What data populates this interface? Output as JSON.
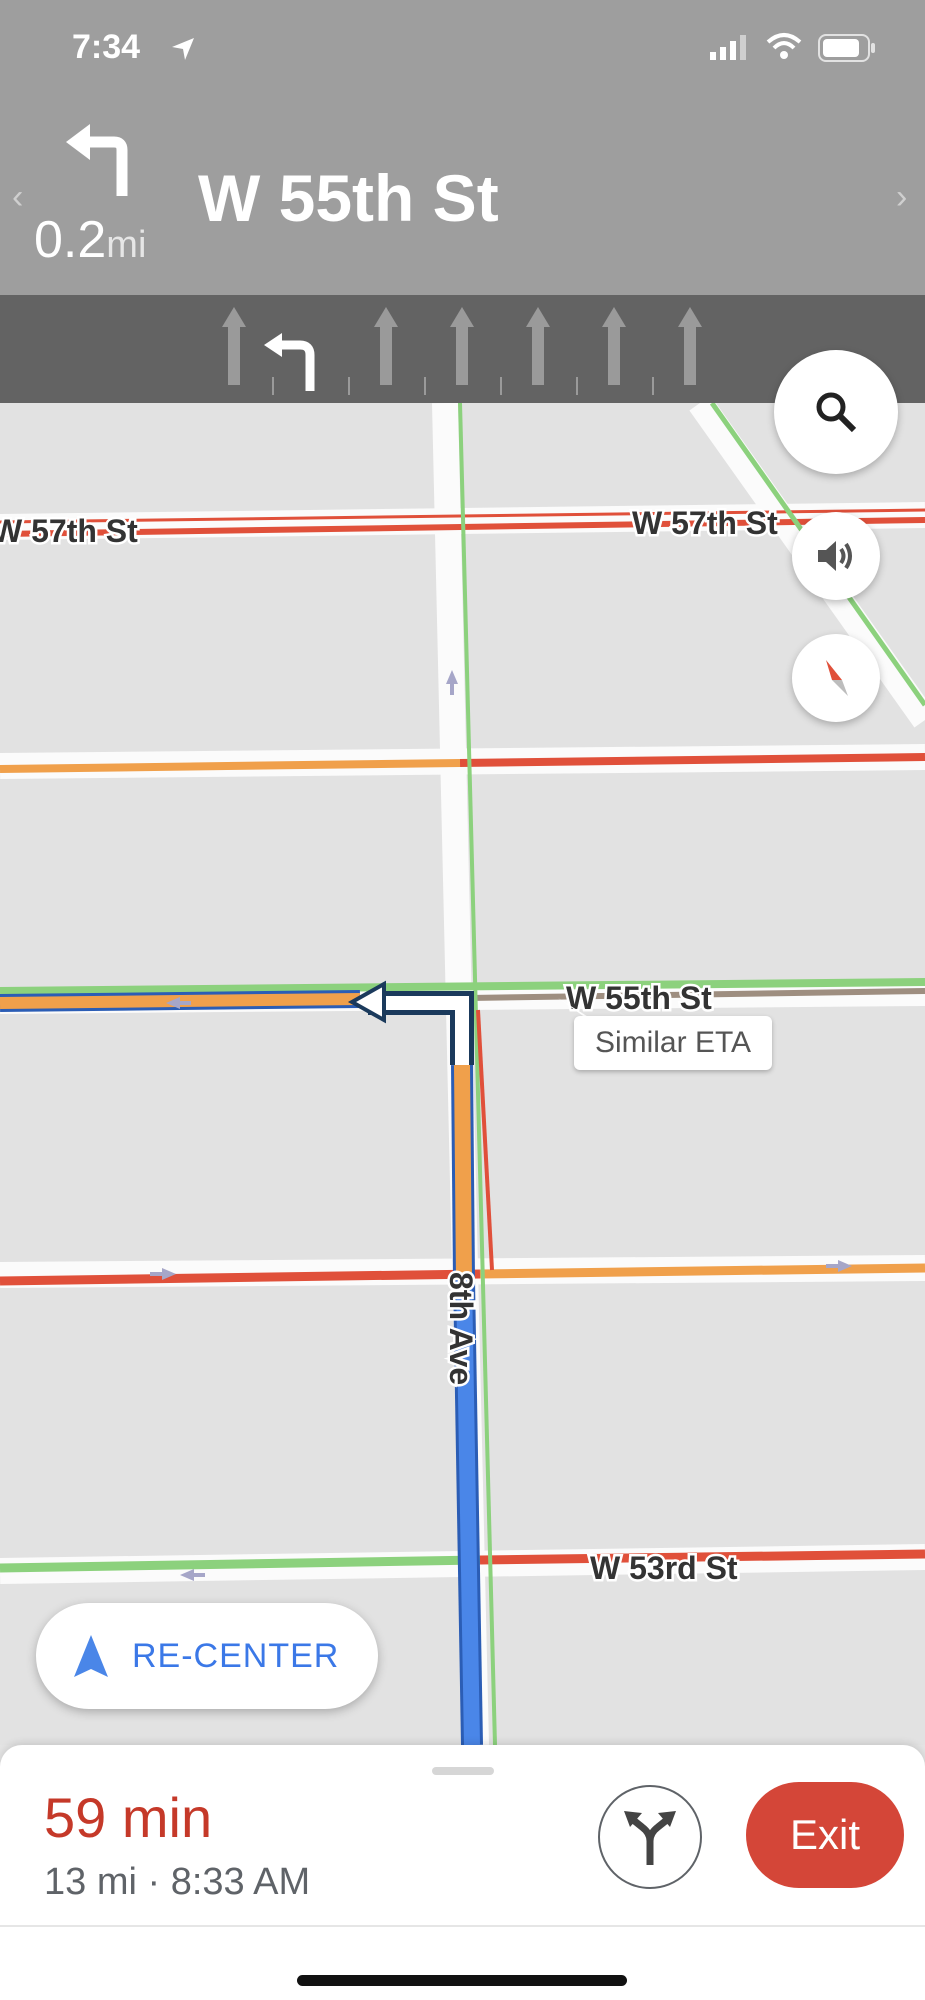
{
  "status_bar": {
    "time": "7:34"
  },
  "navigation": {
    "maneuver": "turn-left",
    "distance_value": "0.2",
    "distance_unit": "mi",
    "street": "W 55th St"
  },
  "lanes": [
    "straight",
    "left-turn",
    "straight",
    "straight",
    "straight",
    "straight",
    "straight"
  ],
  "map": {
    "street_labels": [
      "W 57th St",
      "W 57th St",
      "W 55th St",
      "8th Ave",
      "W 53rd St"
    ],
    "callout": "Similar ETA",
    "colors": {
      "route": "#4a86e8",
      "traffic_heavy": "#e0503a",
      "traffic_moderate": "#f0a04b",
      "traffic_light": "#8cd17d"
    }
  },
  "controls": {
    "search": "search-icon",
    "sound": "speaker-icon",
    "compass": "compass-icon"
  },
  "recenter": {
    "label": "RE-CENTER"
  },
  "trip": {
    "duration": "59 min",
    "details": "13 mi · 8:33 AM",
    "exit_label": "Exit"
  }
}
